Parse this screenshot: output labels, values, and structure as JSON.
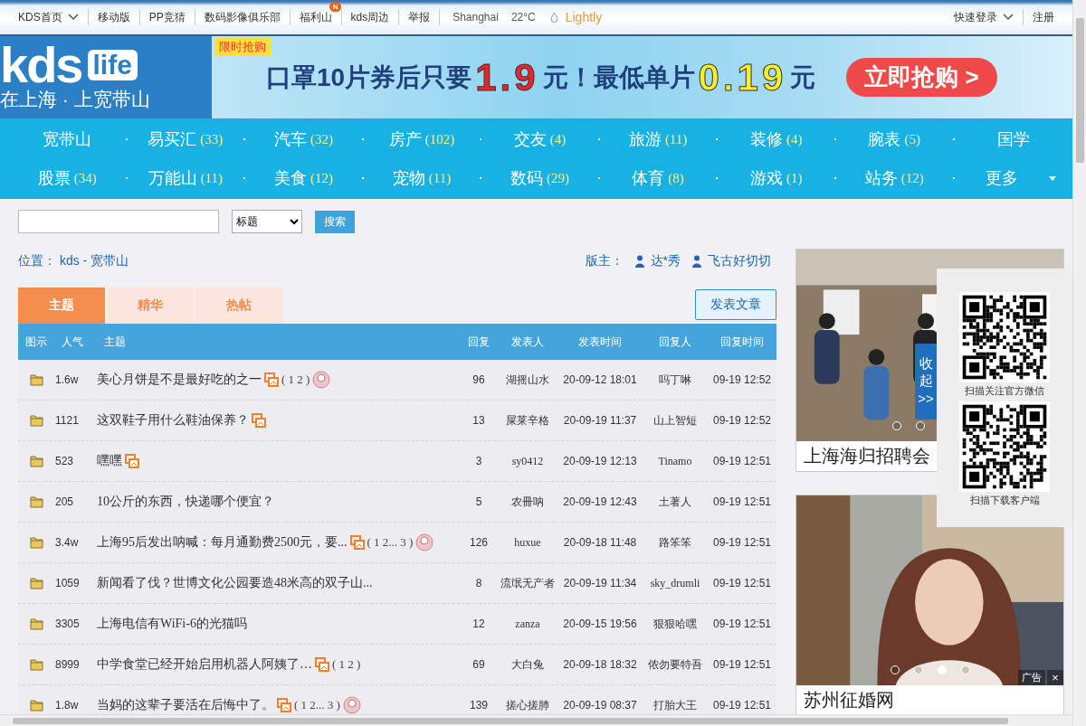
{
  "top_bar": {
    "items": [
      {
        "label": "KDS首页",
        "kind": "dropdown"
      },
      {
        "label": "移动版",
        "kind": "link"
      },
      {
        "label": "PP竞猜",
        "kind": "link"
      },
      {
        "label": "数码影像俱乐部",
        "kind": "link"
      },
      {
        "label": "福利山",
        "kind": "link",
        "badge": "N"
      },
      {
        "label": "kds周边",
        "kind": "link"
      },
      {
        "label": "举报",
        "kind": "link"
      }
    ],
    "weather": {
      "city": "Shanghai",
      "temperature": "22°C",
      "condition": "Lightly"
    },
    "account": [
      {
        "label": "快速登录",
        "kind": "dropdown"
      },
      {
        "label": "注册",
        "kind": "link"
      }
    ]
  },
  "header": {
    "logo": {
      "brand": "kds",
      "tag": "life",
      "tagline": "在上海 · 上宽带山"
    },
    "banner": {
      "tag": "限时抢购",
      "text_1": "口罩10片券后只要",
      "price_1": "1.9",
      "text_2": "元！最低单片",
      "price_2": "0.19",
      "text_3": "元",
      "button": "立即抢购 >"
    }
  },
  "nav": [
    [
      {
        "label": "宽带山"
      },
      {
        "label": "易买汇",
        "count": "(33)"
      },
      {
        "label": "汽车",
        "count": "(32)"
      },
      {
        "label": "房产",
        "count": "(102)"
      },
      {
        "label": "交友",
        "count": "(4)"
      },
      {
        "label": "旅游",
        "count": "(11)"
      },
      {
        "label": "装修",
        "count": "(4)"
      },
      {
        "label": "腕表",
        "count": "(5)"
      },
      {
        "label": "国学"
      }
    ],
    [
      {
        "label": "股票",
        "count": "(34)"
      },
      {
        "label": "万能山",
        "count": "(11)"
      },
      {
        "label": "美食",
        "count": "(12)"
      },
      {
        "label": "宠物",
        "count": "(11)"
      },
      {
        "label": "数码",
        "count": "(29)"
      },
      {
        "label": "体育",
        "count": "(8)"
      },
      {
        "label": "游戏",
        "count": "(1)"
      },
      {
        "label": "站务",
        "count": "(12)"
      },
      {
        "label": "更多",
        "dropdown": true
      }
    ]
  ],
  "search": {
    "scope": "标题",
    "button": "搜索"
  },
  "breadcrumb": {
    "label": "位置：",
    "path": "kds - 宽带山"
  },
  "moderators": {
    "label": "版主：",
    "names": [
      "达*秀",
      "飞古好切切"
    ]
  },
  "tabs": [
    {
      "label": "主题",
      "selected": true
    },
    {
      "label": "精华",
      "selected": false
    },
    {
      "label": "热帖",
      "selected": false
    }
  ],
  "post_button": "发表文章",
  "table": {
    "columns": [
      "图示",
      "人气",
      "主题",
      "回复",
      "发表人",
      "发表时间",
      "回复人",
      "回复时间"
    ],
    "rows": [
      {
        "views": "1.6w",
        "title": "美心月饼是不是最好吃的之一",
        "has_image": true,
        "pages": "( 1  2 )",
        "hot": true,
        "replies": "96",
        "author": "湖摇山水",
        "posted": "20-09-12 18:01",
        "replier": "吗丁啉",
        "replied": "09-19 12:52"
      },
      {
        "views": "1121",
        "title": "这双鞋子用什么鞋油保养？",
        "has_image": true,
        "hot": false,
        "replies": "13",
        "author": "屎莱辛格",
        "posted": "20-09-19 11:37",
        "replier": "山上智短",
        "replied": "09-19 12:52"
      },
      {
        "views": "523",
        "title": "嘿嘿",
        "has_image": true,
        "hot": false,
        "replies": "3",
        "author": "sy0412",
        "posted": "20-09-19 12:13",
        "replier": "Tinamo",
        "replied": "09-19 12:51"
      },
      {
        "views": "205",
        "title": "10公斤的东西，快递哪个便宜？",
        "has_image": false,
        "hot": false,
        "replies": "5",
        "author": "农冊呐",
        "posted": "20-09-19 12:43",
        "replier": "土著人",
        "replied": "09-19 12:51"
      },
      {
        "views": "3.4w",
        "title": "上海95后发出呐喊：每月通勤费2500元，要...",
        "has_image": true,
        "pages": "( 1  2... 3 )",
        "hot": true,
        "replies": "126",
        "author": "huxue",
        "posted": "20-09-18 11:48",
        "replier": "路笨笨",
        "replied": "09-19 12:51"
      },
      {
        "views": "1059",
        "title": "新闻看了伐？世博文化公园要造48米高的双子山...",
        "has_image": false,
        "hot": false,
        "replies": "8",
        "author": "流氓无产者",
        "posted": "20-09-19 11:34",
        "replier": "sky_drumli",
        "replied": "09-19 12:51"
      },
      {
        "views": "3305",
        "title": "上海电信有WiFi-6的光猫吗",
        "has_image": false,
        "hot": false,
        "replies": "12",
        "author": "zanza",
        "posted": "20-09-15 19:56",
        "replier": "狠狠哈嘿",
        "replied": "09-19 12:51"
      },
      {
        "views": "8999",
        "title": "中学食堂已经开始启用机器人阿姨了…",
        "has_image": true,
        "pages": "( 1  2 )",
        "hot": false,
        "replies": "69",
        "author": "大白兔",
        "posted": "20-09-18 18:32",
        "replier": "侬勿要特吾",
        "replied": "09-19 12:51"
      },
      {
        "views": "1.8w",
        "title": "当妈的这辈子要活在后悔中了。",
        "has_image": true,
        "pages": "( 1  2... 3 )",
        "hot": true,
        "replies": "139",
        "author": "搓心搓肺",
        "posted": "20-09-19 08:37",
        "replier": "打胎大王",
        "replied": "09-19 12:51"
      }
    ]
  },
  "sidebar": {
    "ads": [
      {
        "kind": "picture",
        "caption": "上海海归招聘会",
        "dots": [
          {
            "selected": false
          },
          {
            "selected": false
          }
        ]
      },
      {
        "kind": "picture",
        "caption": "苏州征婚网",
        "ad_label": "广告",
        "close": "×",
        "dots": [
          {
            "selected": false
          },
          {
            "selected": false
          },
          {
            "selected": true
          },
          {
            "selected": false
          }
        ]
      }
    ],
    "collapse": {
      "label": "收起",
      "arrow": ">>"
    },
    "qr_codes": [
      {
        "caption": "扫描关注官方微信"
      },
      {
        "caption": "扫描下载客户端"
      }
    ]
  }
}
